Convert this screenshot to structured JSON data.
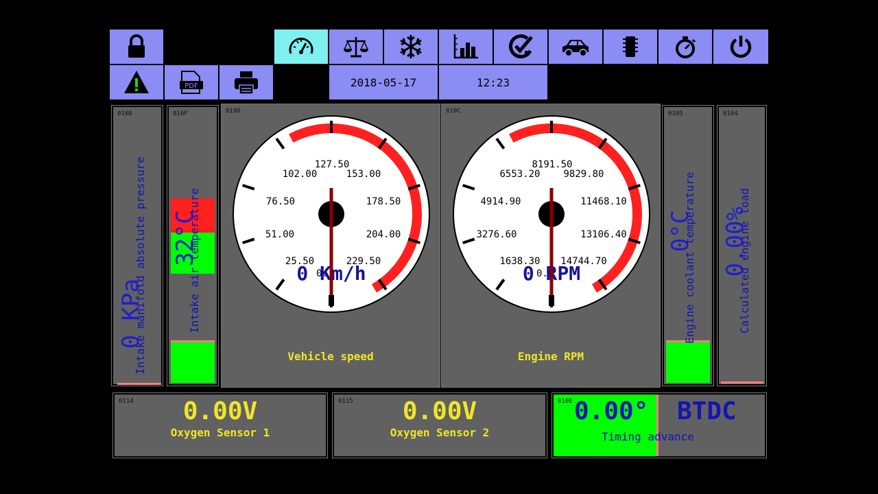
{
  "toolbar": {
    "date": "2018-05-17",
    "time": "12:23"
  },
  "bars": [
    {
      "pid": "010B",
      "label": "Intake manifold absolute pressure",
      "value": "0 KPa"
    },
    {
      "pid": "010F",
      "label": "Intake air temperature",
      "value": "32°C"
    },
    {
      "pid": "0105",
      "label": "Engine coolant temperature",
      "value": "0°C"
    },
    {
      "pid": "0104",
      "label": "Calculated engine load",
      "value": "0.00%"
    }
  ],
  "gauges": {
    "speed": {
      "pid": "010D",
      "title": "Vehicle speed",
      "reading": "0 Km/h",
      "overlap": "0.",
      "ticks": [
        "25.50",
        "51.00",
        "76.50",
        "102.00",
        "127.50",
        "153.00",
        "178.50",
        "204.00",
        "229.50"
      ]
    },
    "rpm": {
      "pid": "010C",
      "title": "Engine RPM",
      "reading": "0 RPM",
      "overlap": "0.0",
      "ticks": [
        "1638.30",
        "3276.60",
        "4914.90",
        "6553.20",
        "8191.50",
        "9829.80",
        "11468.10",
        "13106.40",
        "14744.70"
      ]
    }
  },
  "sensors": [
    {
      "pid": "0114",
      "value": "0.00V",
      "label": "Oxygen Sensor 1"
    },
    {
      "pid": "0115",
      "value": "0.00V",
      "label": "Oxygen Sensor 2"
    }
  ],
  "timing": {
    "pid": "010E",
    "value": "0.00°",
    "unit": "BTDC",
    "label": "Timing advance"
  },
  "colors": {
    "button": "#8c8cf5",
    "active": "#7ff0f0",
    "panel": "#616161",
    "yellow": "#f0e628",
    "blue": "#1414b4",
    "green": "#00ff00",
    "red": "#ff2020"
  }
}
